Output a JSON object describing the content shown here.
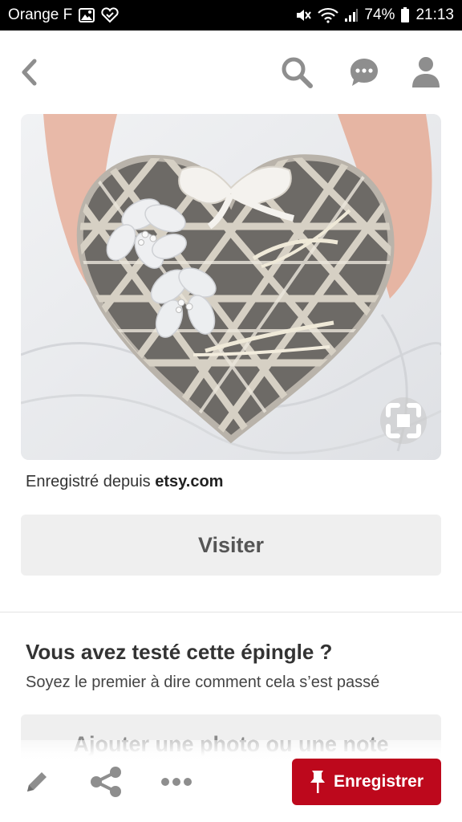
{
  "status_bar": {
    "carrier": "Orange F",
    "battery": "74%",
    "time": "21:13"
  },
  "nav": {
    "icons": [
      "chevron-left-icon",
      "search-icon",
      "chat-bubble-icon",
      "user-icon"
    ]
  },
  "pin": {
    "saved_from_prefix": "Enregistré depuis",
    "saved_from_domain": "etsy.com",
    "visit_label": "Visiter"
  },
  "tried": {
    "title": "Vous avez testé cette épingle ?",
    "subtitle": "Soyez le premier à dire comment cela s’est passé",
    "add_photo_label": "Ajouter une photo ou une note"
  },
  "actions": {
    "save_label": "Enregistrer",
    "icons": [
      "pencil-icon",
      "share-icon",
      "more-icon",
      "pushpin-icon"
    ]
  },
  "colors": {
    "status_bar_bg": "#000000",
    "save_button": "#bd081c",
    "button_gray": "#efefef",
    "icon_gray": "#8e8e8e"
  }
}
